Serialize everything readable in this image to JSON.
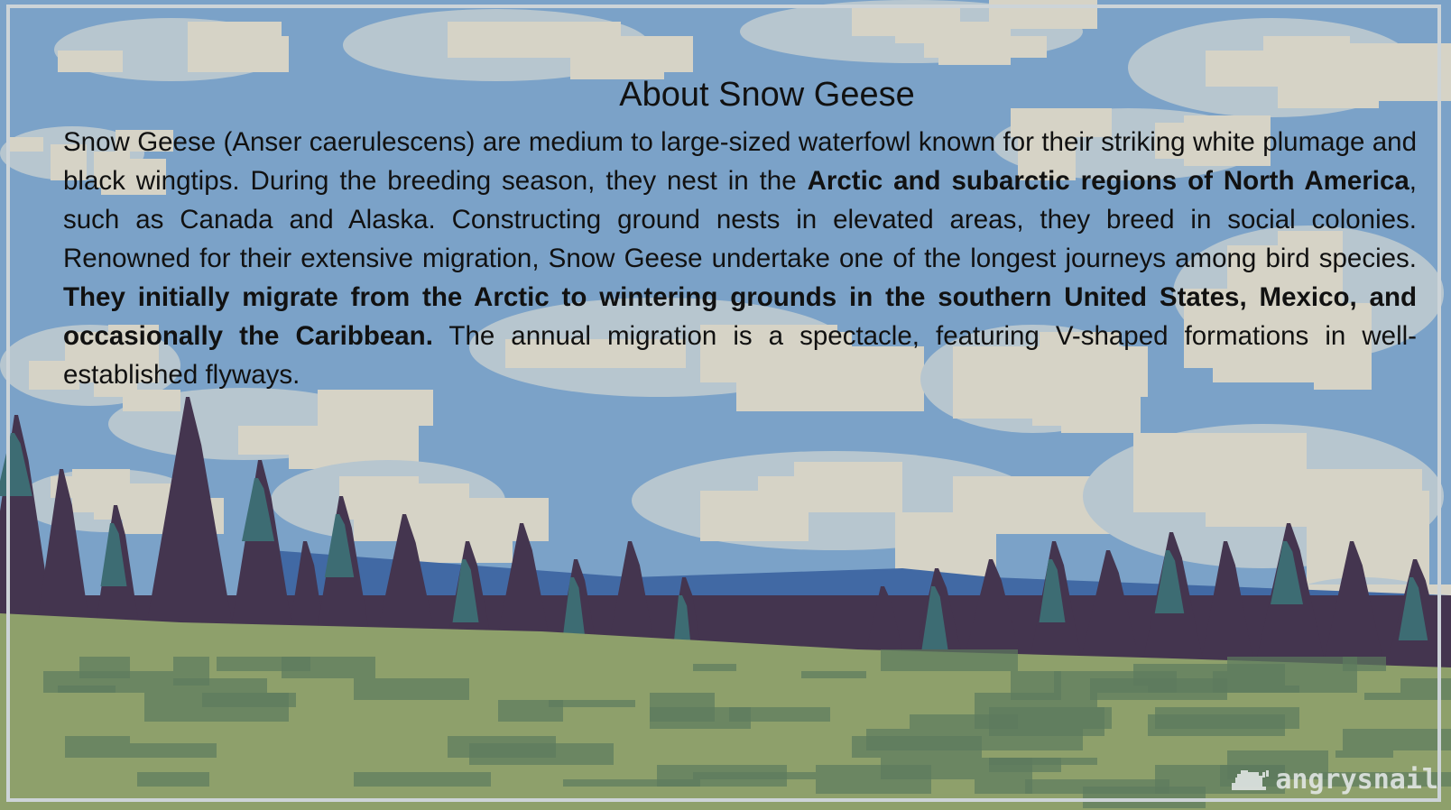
{
  "page": {
    "title": "About Snow Geese",
    "paragraph": [
      {
        "text": "Snow Geese (Anser caerulescens) are medium to large-sized waterfowl known for their striking white plumage and black wingtips. During the breeding season, they nest in the ",
        "bold": false
      },
      {
        "text": "Arctic and subarctic regions of North America",
        "bold": true
      },
      {
        "text": ", such as Canada and Alaska. Constructing ground nests in elevated areas, they breed in social colonies. Renowned for their extensive migration, Snow Geese undertake one of the longest journeys among bird species. ",
        "bold": false
      },
      {
        "text": "They initially migrate from the Arctic to wintering grounds in the southern United States, Mexico, and occasionally the Caribbean.",
        "bold": true
      },
      {
        "text": " The annual migration is a spectacle, featuring V-shaped formations in well-established flyways.",
        "bold": false
      }
    ]
  },
  "watermark": {
    "text": "angrysnail",
    "icon": "snail-icon"
  },
  "colors": {
    "sky": "#7ba2c8",
    "cloud_light": "#d6d3c6",
    "cloud_mid": "#b7c6cf",
    "trees_dark": "#44354f",
    "trees_teal": "#3d6c73",
    "lake": "#4169a4",
    "grass": "#8ea06b",
    "grass_dark": "#5d7a5e",
    "frame": "#cdd4d8"
  }
}
